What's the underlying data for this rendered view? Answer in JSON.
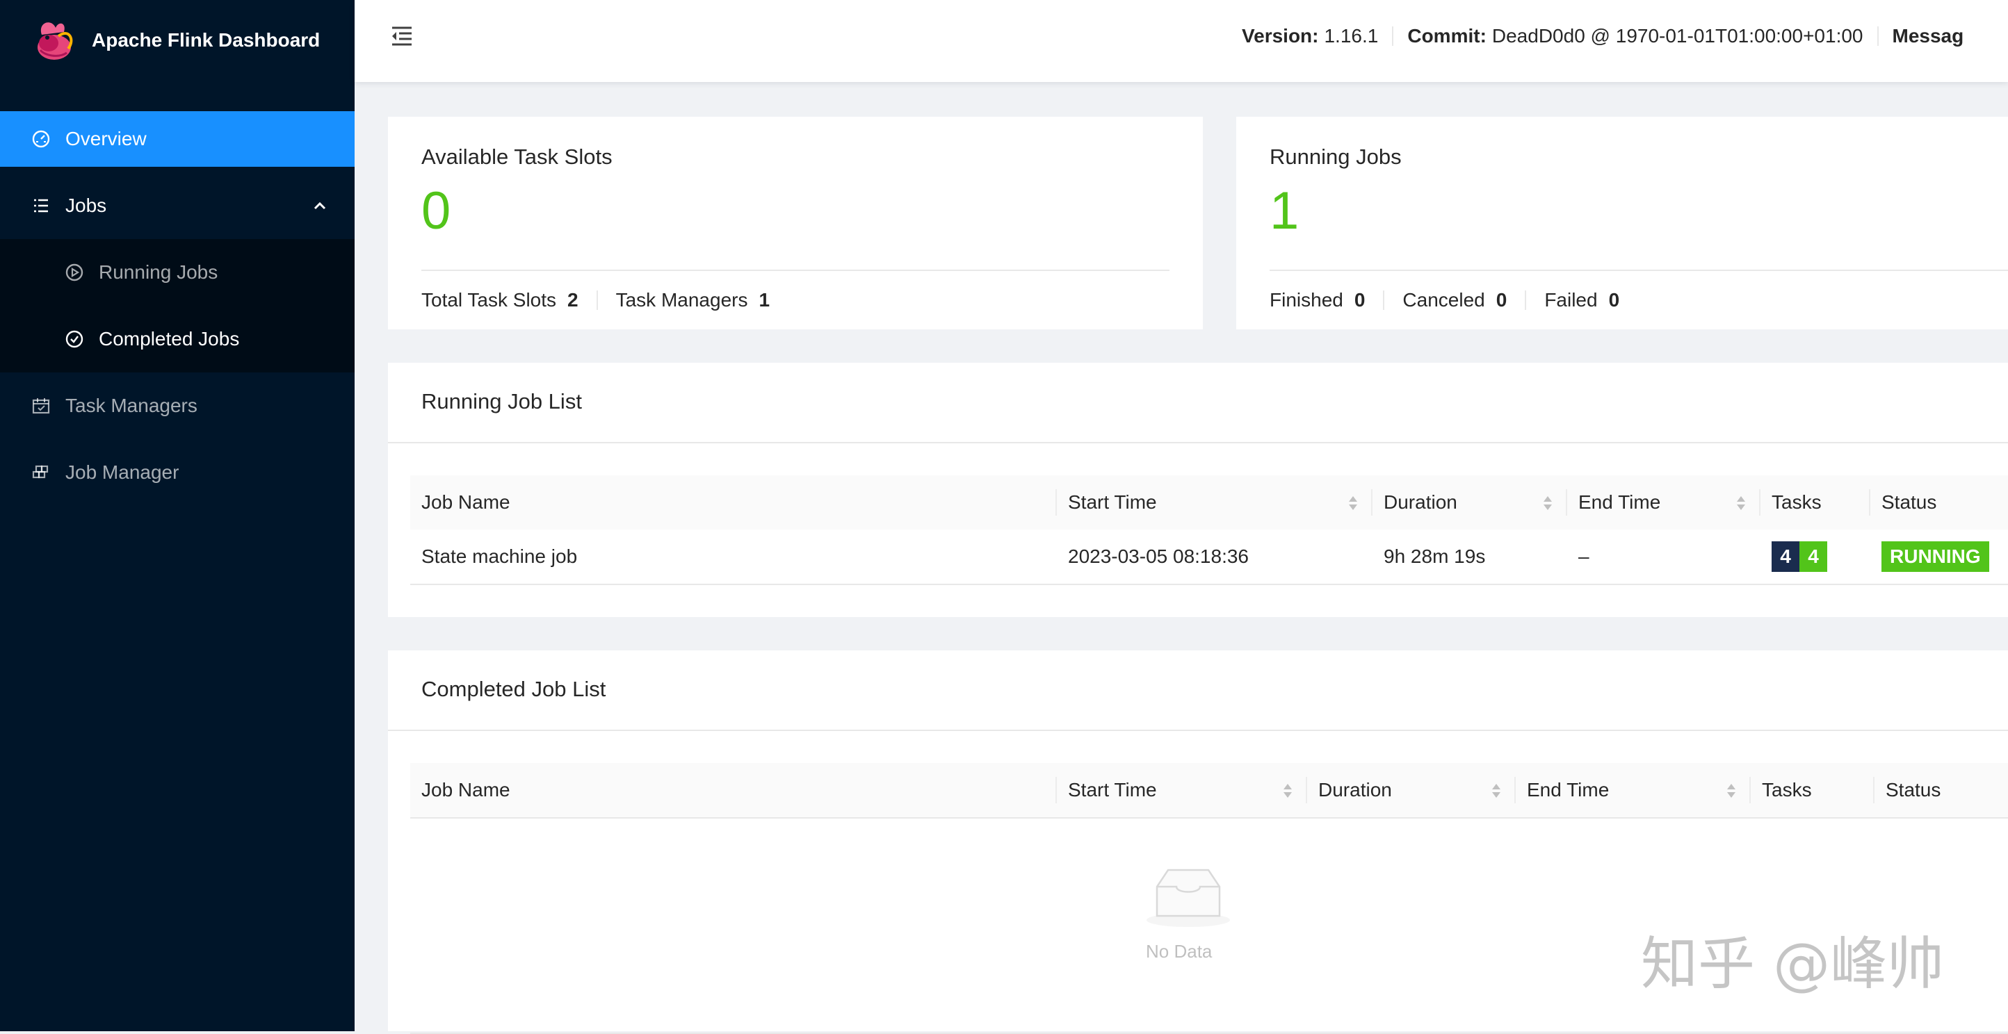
{
  "app": {
    "title": "Apache Flink Dashboard"
  },
  "sidebar": {
    "items": [
      {
        "label": "Overview",
        "icon": "dashboard-icon",
        "active": true
      },
      {
        "label": "Jobs",
        "icon": "list-icon",
        "expanded": true,
        "children": [
          {
            "label": "Running Jobs",
            "icon": "play-circle-icon"
          },
          {
            "label": "Completed Jobs",
            "icon": "check-circle-icon"
          }
        ]
      },
      {
        "label": "Task Managers",
        "icon": "schedule-icon"
      },
      {
        "label": "Job Manager",
        "icon": "build-icon"
      }
    ]
  },
  "header": {
    "version_label": "Version:",
    "version": "1.16.1",
    "commit_label": "Commit:",
    "commit": "DeadD0d0 @ 1970-01-01T01:00:00+01:00",
    "message_label": "Messag"
  },
  "stats": {
    "task_slots": {
      "title": "Available Task Slots",
      "value": "0",
      "total_label": "Total Task Slots",
      "total_value": "2",
      "tm_label": "Task Managers",
      "tm_value": "1"
    },
    "running_jobs": {
      "title": "Running Jobs",
      "value": "1",
      "finished_label": "Finished",
      "finished_value": "0",
      "canceled_label": "Canceled",
      "canceled_value": "0",
      "failed_label": "Failed",
      "failed_value": "0"
    }
  },
  "running_list": {
    "title": "Running Job List",
    "columns": [
      "Job Name",
      "Start Time",
      "Duration",
      "End Time",
      "Tasks",
      "Status"
    ],
    "rows": [
      {
        "name": "State machine job",
        "start": "2023-03-05 08:18:36",
        "duration": "9h 28m 19s",
        "end": "–",
        "tasks_a": "4",
        "tasks_b": "4",
        "status": "RUNNING"
      }
    ]
  },
  "completed_list": {
    "title": "Completed Job List",
    "columns": [
      "Job Name",
      "Start Time",
      "Duration",
      "End Time",
      "Tasks",
      "Status"
    ],
    "empty_text": "No Data"
  },
  "watermark": "知乎 @峰帅",
  "colors": {
    "sidebar": "#001529",
    "active": "#1890ff",
    "success": "#52c41a",
    "badge_dark": "#1a2c4e"
  }
}
